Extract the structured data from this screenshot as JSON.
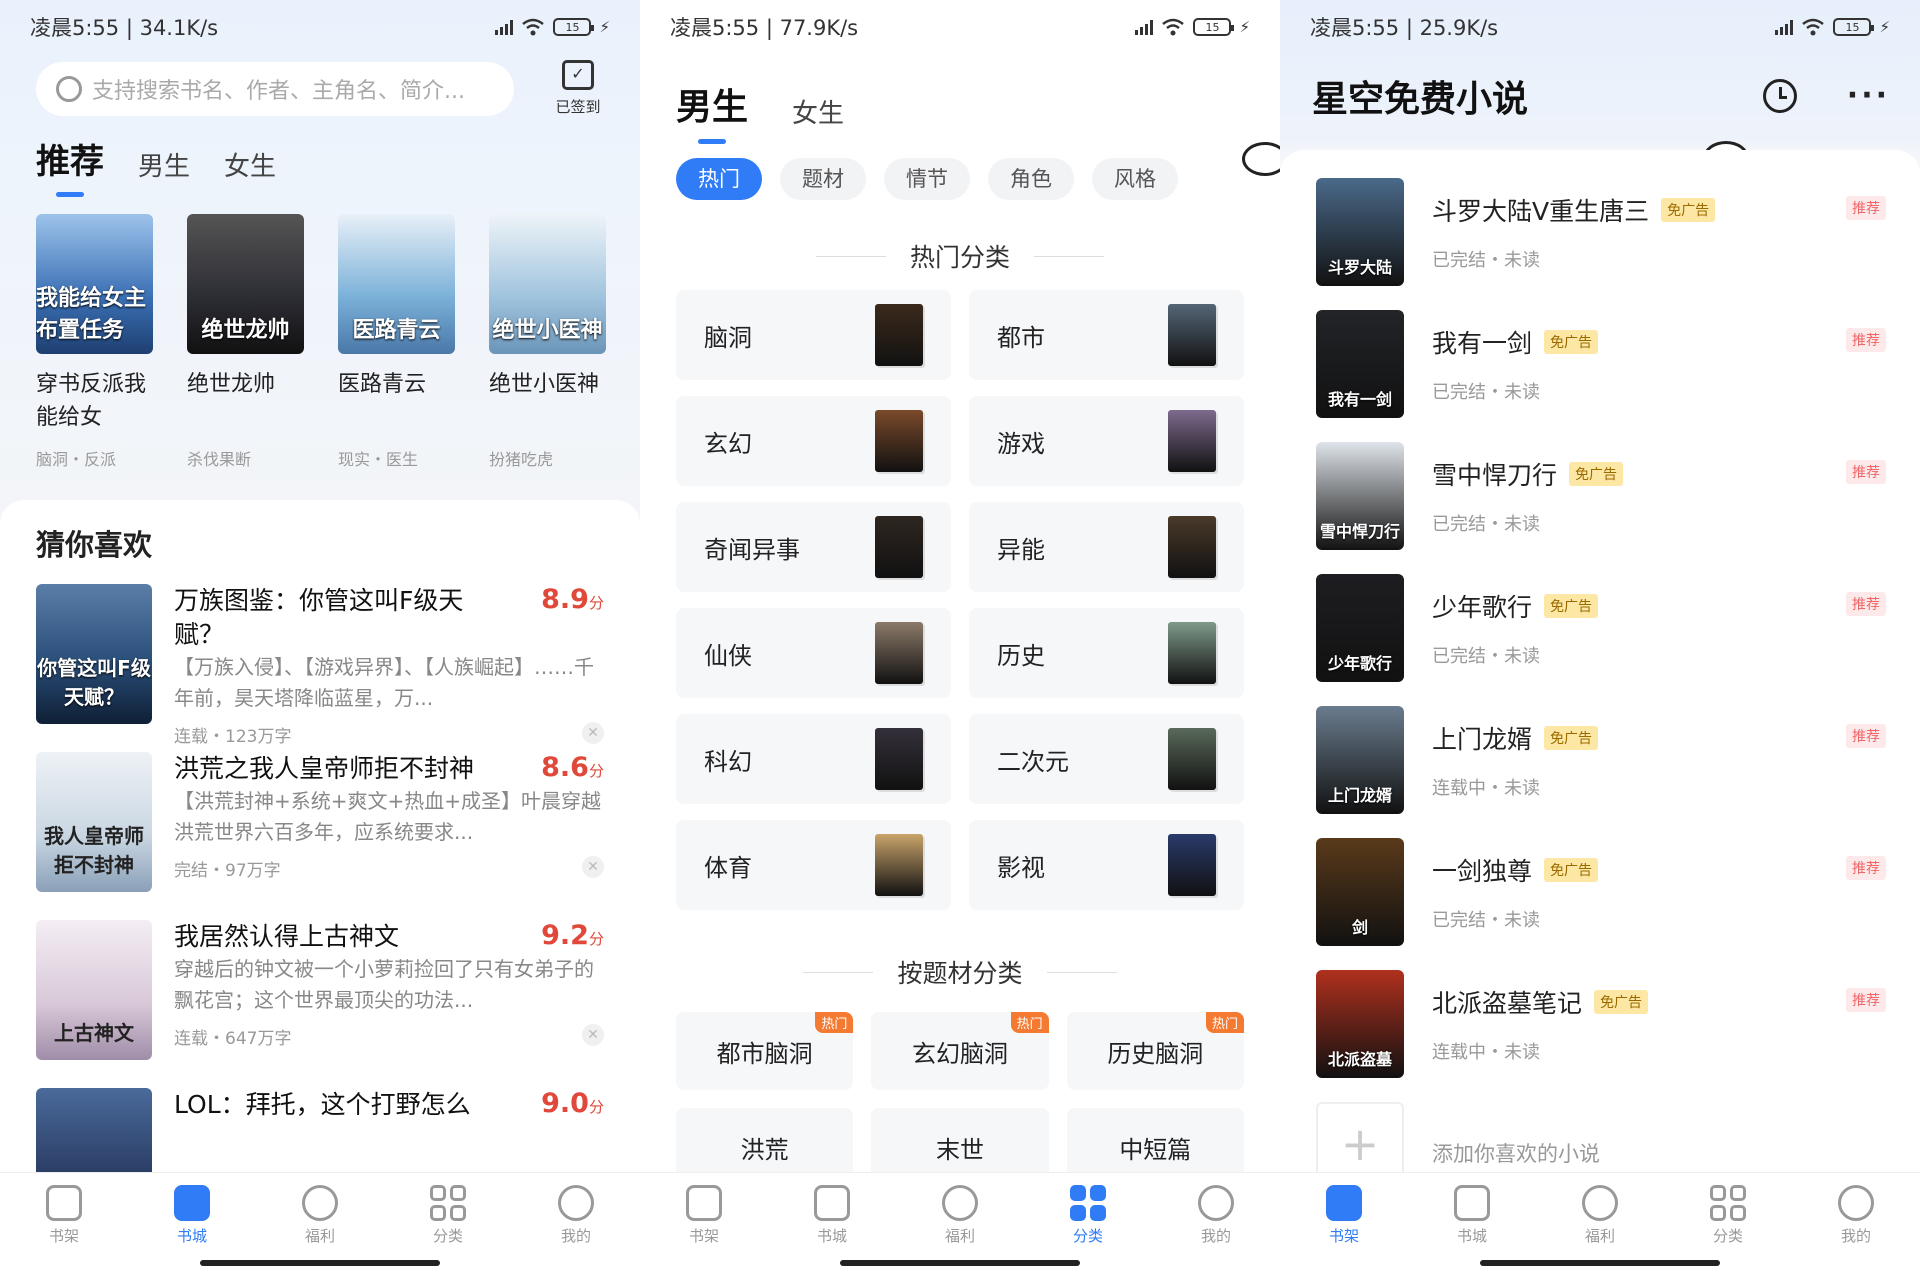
{
  "status": [
    {
      "time": "凌晨5:55 | 34.1K/s",
      "battery": "15"
    },
    {
      "time": "凌晨5:55 | 77.9K/s",
      "battery": "15"
    },
    {
      "time": "凌晨5:55 | 25.9K/s",
      "battery": "15"
    }
  ],
  "store": {
    "search_placeholder": "支持搜索书名、作者、主角名、简介...",
    "checkin_label": "已签到",
    "tabs": [
      "推荐",
      "男生",
      "女生"
    ],
    "recommended": [
      {
        "title": "穿书反派我能给女",
        "tags": "脑洞・反派",
        "cover_text": "我能给女主布置任务",
        "color": "#3a6fb4"
      },
      {
        "title": "绝世龙帅",
        "tags": "杀伐果断",
        "cover_text": "绝世龙帅",
        "color": "#2c2c34"
      },
      {
        "title": "医路青云",
        "tags": "现实・医生",
        "cover_text": "医路青云",
        "color": "#7ab0d8"
      },
      {
        "title": "绝世小医神",
        "tags": "扮猪吃虎",
        "cover_text": "绝世小医神",
        "color": "#9fc3dd"
      }
    ],
    "guess_title": "猜你喜欢",
    "books": [
      {
        "title": "万族图鉴：你管这叫F级天赋？",
        "score": "8.9",
        "unit": "分",
        "desc": "【万族入侵】、【游戏异界】、【人族崛起】……千年前，昊天塔降临蓝星，万...",
        "meta": "连载・123万字",
        "cover_text": "你管这叫F级天赋？",
        "color": "#2a4f7a"
      },
      {
        "title": "洪荒之我人皇帝师拒不封神",
        "score": "8.6",
        "unit": "分",
        "desc": "【洪荒封神+系统+爽文+热血+成圣】叶晨穿越洪荒世界六百多年，应系统要求...",
        "meta": "完结・97万字",
        "cover_text": "我人皇帝师拒不封神",
        "color": "#c9d6e2"
      },
      {
        "title": "我居然认得上古神文",
        "score": "9.2",
        "unit": "分",
        "desc": "穿越后的钟文被一个小萝莉捡回了只有女弟子的飘花宫；这个世界最顶尖的功法...",
        "meta": "连载・647万字",
        "cover_text": "上古神文",
        "color": "#d8c8d8"
      },
      {
        "title": "LOL：拜托，这个打野怎么",
        "score": "9.0",
        "unit": "分",
        "desc": "",
        "meta": "",
        "cover_text": "",
        "color": "#2b3e66"
      }
    ]
  },
  "nav": {
    "labels": [
      "书架",
      "书城",
      "福利",
      "分类",
      "我的"
    ],
    "accent": "#2f7cf6"
  },
  "category": {
    "tabs": [
      "男生",
      "女生"
    ],
    "chips": [
      "热门",
      "题材",
      "情节",
      "角色",
      "风格"
    ],
    "hot_title": "热门分类",
    "hot": [
      {
        "name": "脑洞",
        "color": "#3b2a1c"
      },
      {
        "name": "都市",
        "color": "#556677"
      },
      {
        "name": "玄幻",
        "color": "#7a4a2a"
      },
      {
        "name": "游戏",
        "color": "#7e6a8e"
      },
      {
        "name": "奇闻异事",
        "color": "#2e2620"
      },
      {
        "name": "异能",
        "color": "#4a3a2a"
      },
      {
        "name": "仙侠",
        "color": "#8c7a6a"
      },
      {
        "name": "历史",
        "color": "#7f9a8a"
      },
      {
        "name": "科幻",
        "color": "#34303a"
      },
      {
        "name": "二次元",
        "color": "#5a6a5a"
      },
      {
        "name": "体育",
        "color": "#c9a46a"
      },
      {
        "name": "影视",
        "color": "#2a3a6a"
      }
    ],
    "theme_title": "按题材分类",
    "hot_badge": "热门",
    "themes": [
      {
        "name": "都市脑洞",
        "hot": true
      },
      {
        "name": "玄幻脑洞",
        "hot": true
      },
      {
        "name": "历史脑洞",
        "hot": true
      },
      {
        "name": "洪荒",
        "hot": false
      },
      {
        "name": "末世",
        "hot": false
      },
      {
        "name": "中短篇",
        "hot": false
      }
    ]
  },
  "shelf": {
    "app_title": "星空免费小说",
    "noad_label": "免广告",
    "rec_label": "推荐",
    "books": [
      {
        "title": "斗罗大陆V重生唐三",
        "status": "已完结・未读",
        "color": "#4a6a8a",
        "cover_text": "斗罗大陆"
      },
      {
        "title": "我有一剑",
        "status": "已完结・未读",
        "color": "#222428",
        "cover_text": "我有一剑"
      },
      {
        "title": "雪中悍刀行",
        "status": "已完结・未读",
        "color": "#dfe4ea",
        "cover_text": "雪中悍刀行"
      },
      {
        "title": "少年歌行",
        "status": "已完结・未读",
        "color": "#1e1e22",
        "cover_text": "少年歌行"
      },
      {
        "title": "上门龙婿",
        "status": "连载中・未读",
        "color": "#6a7c8e",
        "cover_text": "上门龙婿"
      },
      {
        "title": "一剑独尊",
        "status": "已完结・未读",
        "color": "#5a3a1a",
        "cover_text": "剑"
      },
      {
        "title": "北派盗墓笔记",
        "status": "连载中・未读",
        "color": "#b0301e",
        "cover_text": "北派盗墓"
      }
    ],
    "add_text": "添加你喜欢的小说"
  }
}
